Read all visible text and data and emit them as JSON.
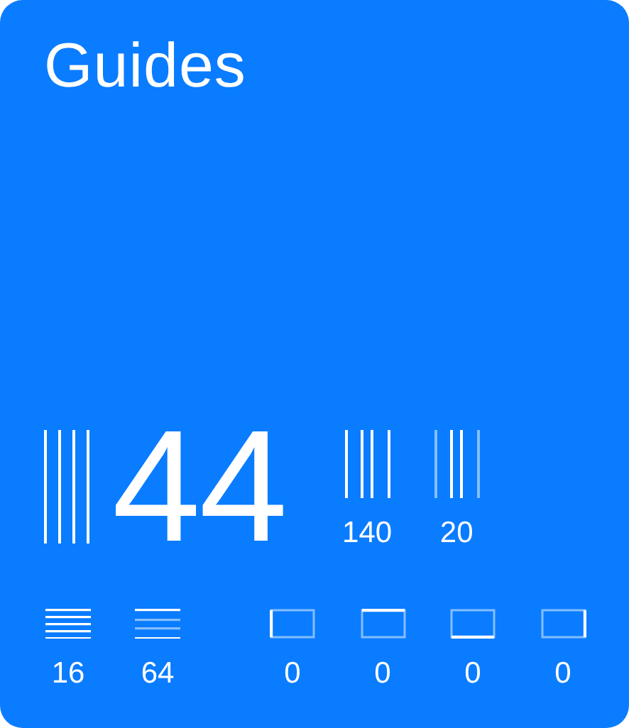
{
  "title": "Guides",
  "main": {
    "value": "44"
  },
  "column_stats": [
    {
      "kind": "columns",
      "value": "140"
    },
    {
      "kind": "gutter",
      "value": "20"
    }
  ],
  "row_stats": [
    {
      "kind": "rows",
      "value": "16"
    },
    {
      "kind": "row-gutter",
      "value": "64"
    }
  ],
  "margins": [
    {
      "kind": "left",
      "value": "0"
    },
    {
      "kind": "top",
      "value": "0"
    },
    {
      "kind": "bottom",
      "value": "0"
    },
    {
      "kind": "right",
      "value": "0"
    }
  ]
}
